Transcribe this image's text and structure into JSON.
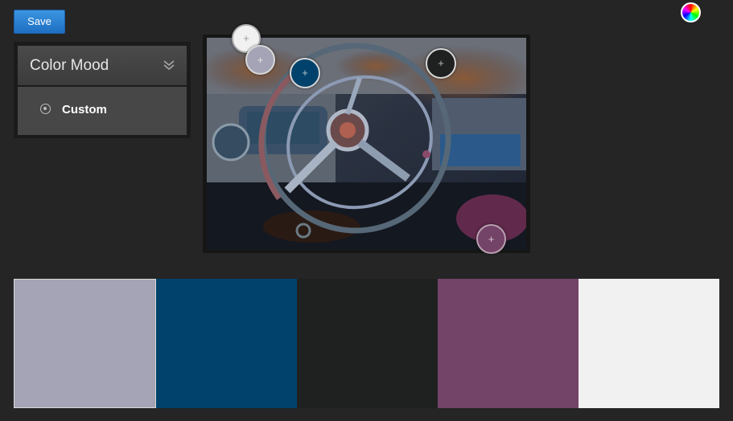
{
  "toolbar": {
    "save_label": "Save"
  },
  "panel": {
    "title": "Color Mood",
    "items": [
      {
        "label": "Custom",
        "selected": true
      }
    ]
  },
  "icons": {
    "color_wheel": "color-wheel-icon",
    "collapse": "double-chevron-down-icon",
    "radio": "radio-selected-icon",
    "handle": "plus-icon"
  },
  "handle_symbol": "+",
  "photo": {
    "description_icon": "car-dashboard-photo"
  },
  "swatches": [
    {
      "color": "#a4a4b6",
      "selected": true
    },
    {
      "color": "#00426c",
      "selected": false
    },
    {
      "color": "#1f2020",
      "selected": false
    },
    {
      "color": "#744368",
      "selected": false
    },
    {
      "color": "#f1f1f1",
      "selected": false
    }
  ]
}
